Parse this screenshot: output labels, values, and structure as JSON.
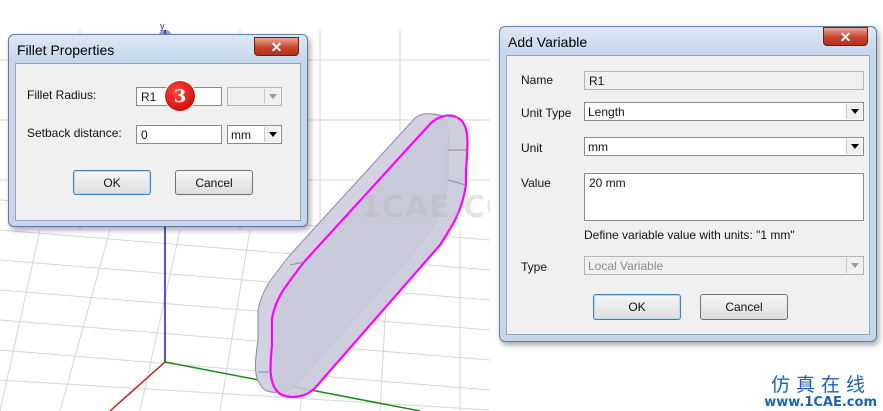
{
  "viewport": {
    "axis_label": "y"
  },
  "fillet_dialog": {
    "title": "Fillet Properties",
    "close_glyph": "✕",
    "fillet_radius_label": "Fillet Radius:",
    "fillet_radius_value": "R1",
    "fillet_radius_unit": "",
    "setback_label": "Setback distance:",
    "setback_value": "0",
    "setback_unit": "mm",
    "ok_label": "OK",
    "cancel_label": "Cancel",
    "step_badge": "3"
  },
  "add_variable_dialog": {
    "title": "Add Variable",
    "close_glyph": "✕",
    "name_label": "Name",
    "name_value": "R1",
    "unit_type_label": "Unit Type",
    "unit_type_value": "Length",
    "unit_label": "Unit",
    "unit_value": "mm",
    "value_label": "Value",
    "value_value": "20 mm",
    "hint": "Define variable value with units: \"1 mm\"",
    "type_label": "Type",
    "type_value": "Local Variable",
    "ok_label": "OK",
    "cancel_label": "Cancel"
  },
  "watermark": {
    "text": "1CAE.COM",
    "site_name": "仿真在线",
    "site_url": "www.1CAE.com"
  },
  "colors": {
    "dialog_frame": "#c7d6e8",
    "close_button": "#c7452d",
    "badge": "#d4110b",
    "edge_highlight": "#ff00ff",
    "axis_x": "#1a8a1a",
    "axis_y": "#1a1acc",
    "axis_z": "#cc1a1a",
    "site_text": "#1a63b5"
  }
}
